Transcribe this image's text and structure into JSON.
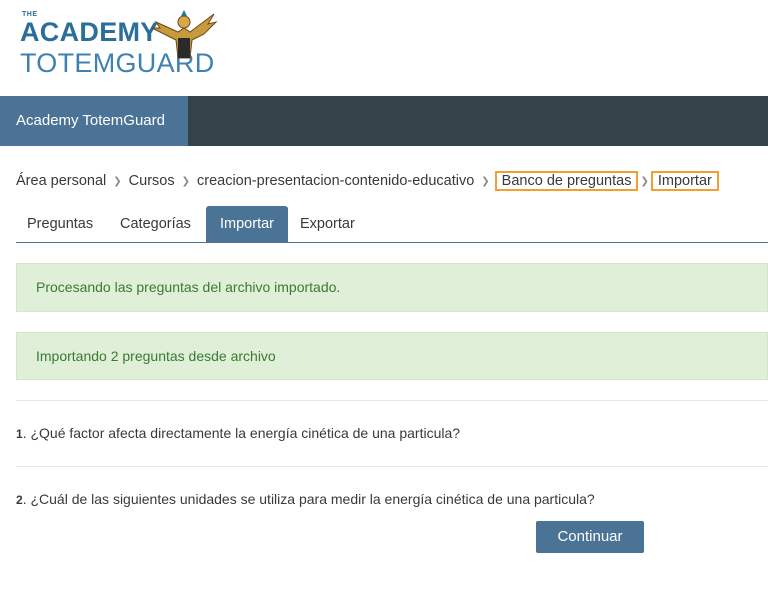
{
  "logo": {
    "small": "THE",
    "line1": "ACADEMY",
    "line2": "TOTEMGUARD"
  },
  "navbar": {
    "brand": "Academy TotemGuard"
  },
  "breadcrumb": [
    {
      "label": "Área personal"
    },
    {
      "label": "Cursos"
    },
    {
      "label": "creacion-presentacion-contenido-educativo"
    },
    {
      "label": "Banco de preguntas"
    },
    {
      "label": "Importar"
    }
  ],
  "tabs": [
    {
      "label": "Preguntas",
      "active": false
    },
    {
      "label": "Categorías",
      "active": false
    },
    {
      "label": "Importar",
      "active": true
    },
    {
      "label": "Exportar",
      "active": false
    }
  ],
  "alerts": [
    "Procesando las preguntas del archivo importado.",
    "Importando 2 preguntas desde archivo"
  ],
  "questions": [
    {
      "number": "1",
      "text": ". ¿Qué factor afecta directamente la energía cinética de una particula?"
    },
    {
      "number": "2",
      "text": ". ¿Cuál de las siguientes unidades se utiliza para medir la energía cinética de una particula?"
    }
  ],
  "continue_button": "Continuar",
  "colors": {
    "brand": "#4a7396",
    "navbar": "#36424a",
    "success_bg": "#e0efd8",
    "success_text": "#3a7a32",
    "highlight": "#f0a030"
  }
}
